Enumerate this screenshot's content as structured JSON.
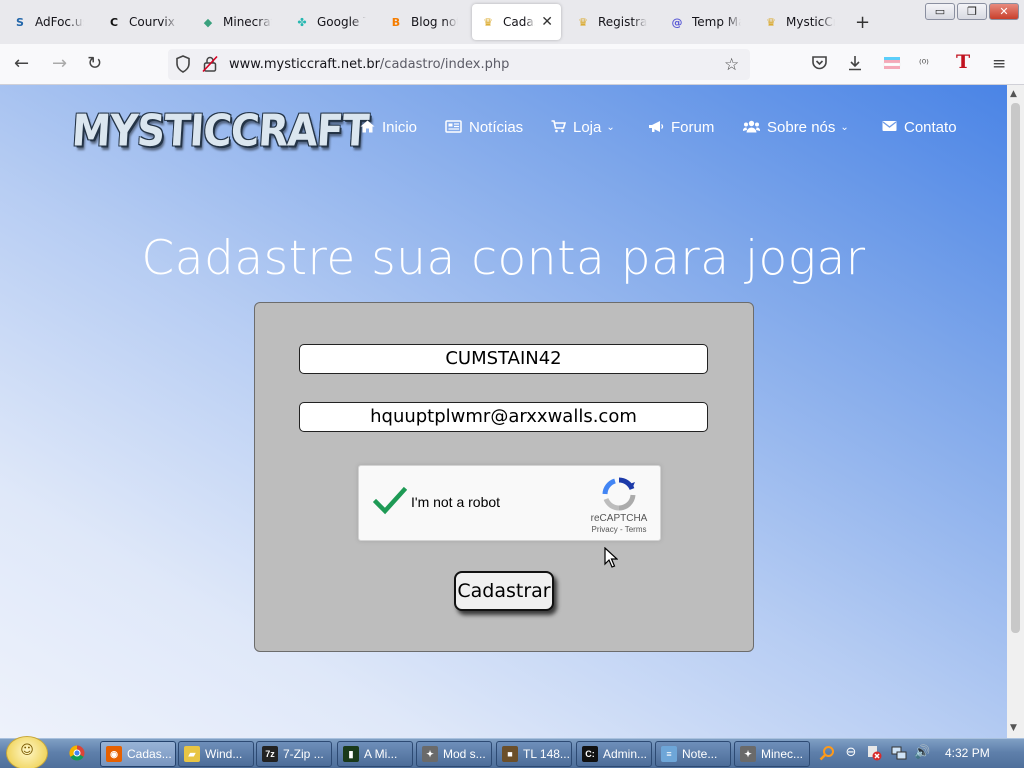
{
  "browser": {
    "tabs": [
      {
        "title": "AdFoc.us",
        "icon": "adfocus-icon",
        "color": "#2266aa",
        "glyph": "S"
      },
      {
        "title": "Courvix N",
        "icon": "courvix-icon",
        "color": "#111111",
        "glyph": "C"
      },
      {
        "title": "Minecraft",
        "icon": "minecraft-cube-icon",
        "color": "#3aa17e",
        "glyph": "◆"
      },
      {
        "title": "Google Tr",
        "icon": "puzzle-icon",
        "color": "#25b7b0",
        "glyph": "✤"
      },
      {
        "title": "Blog not f",
        "icon": "blogger-icon",
        "color": "#f57d00",
        "glyph": "B"
      },
      {
        "title": "Cadast",
        "icon": "mysticcraft-icon",
        "color": "#d9a520",
        "glyph": "♛"
      },
      {
        "title": "Registrati",
        "icon": "mysticcraft-icon",
        "color": "#d9a520",
        "glyph": "♛"
      },
      {
        "title": "Temp Ma",
        "icon": "at-sign-icon",
        "color": "#5b5bd6",
        "glyph": "@"
      },
      {
        "title": "MysticCra",
        "icon": "mysticcraft-icon",
        "color": "#d9a520",
        "glyph": "♛"
      }
    ],
    "active_tab": 5,
    "close_glyph": "✕",
    "new_tab_glyph": "+",
    "url_host": "www.mysticcraft.net.br",
    "url_path": "/cadastro/index.php",
    "window_controls": {
      "minimize": "▭",
      "restore": "❐",
      "close": "✕"
    }
  },
  "site": {
    "logo": "MYSTICCRAFT",
    "nav": [
      {
        "label": "Inicio",
        "icon": "home-icon",
        "glyph": "⌂",
        "dropdown": false
      },
      {
        "label": "Notícias",
        "icon": "newspaper-icon",
        "glyph": "▤",
        "dropdown": false
      },
      {
        "label": "Loja",
        "icon": "cart-icon",
        "glyph": "🛒",
        "dropdown": true
      },
      {
        "label": "Forum",
        "icon": "megaphone-icon",
        "glyph": "📢",
        "dropdown": false
      },
      {
        "label": "Sobre nós",
        "icon": "users-icon",
        "glyph": "👥",
        "dropdown": true
      },
      {
        "label": "Contato",
        "icon": "envelope-icon",
        "glyph": "✉",
        "dropdown": false
      }
    ],
    "heading": "Cadastre sua conta para jogar",
    "form": {
      "username": "CUMSTAIN42",
      "email": "hquuptplwmr@arxxwalls.com",
      "captcha_label": "I'm not a robot",
      "captcha_brand": "reCAPTCHA",
      "captcha_links": "Privacy - Terms",
      "captcha_checked": true,
      "submit": "Cadastrar"
    },
    "colors": {
      "panel": "#bdbdbd",
      "accent_check": "#1e9a55"
    }
  },
  "taskbar": {
    "items": [
      {
        "label": "Cadas...",
        "icon": "firefox-icon",
        "color": "#e66000",
        "glyph": "◉",
        "active": true
      },
      {
        "label": "Wind...",
        "icon": "folder-icon",
        "color": "#e8c544",
        "glyph": "▰"
      },
      {
        "label": "7-Zip ...",
        "icon": "7zip-icon",
        "color": "#222222",
        "glyph": "7z"
      },
      {
        "label": "A Mi...",
        "icon": "terminal-icon",
        "color": "#1a3a1a",
        "glyph": "▮"
      },
      {
        "label": "Mod s...",
        "icon": "mod-icon",
        "color": "#6a6a6a",
        "glyph": "✦"
      },
      {
        "label": "TL 148...",
        "icon": "minecraft-block-icon",
        "color": "#6b4f2a",
        "glyph": "■"
      },
      {
        "label": "Admin...",
        "icon": "cmd-icon",
        "color": "#111111",
        "glyph": "C:"
      },
      {
        "label": "Note...",
        "icon": "notepad-icon",
        "color": "#6ea6d8",
        "glyph": "≡"
      },
      {
        "label": "Minec...",
        "icon": "mod-icon",
        "color": "#6a6a6a",
        "glyph": "✦"
      }
    ],
    "clock": "4:32 PM"
  }
}
